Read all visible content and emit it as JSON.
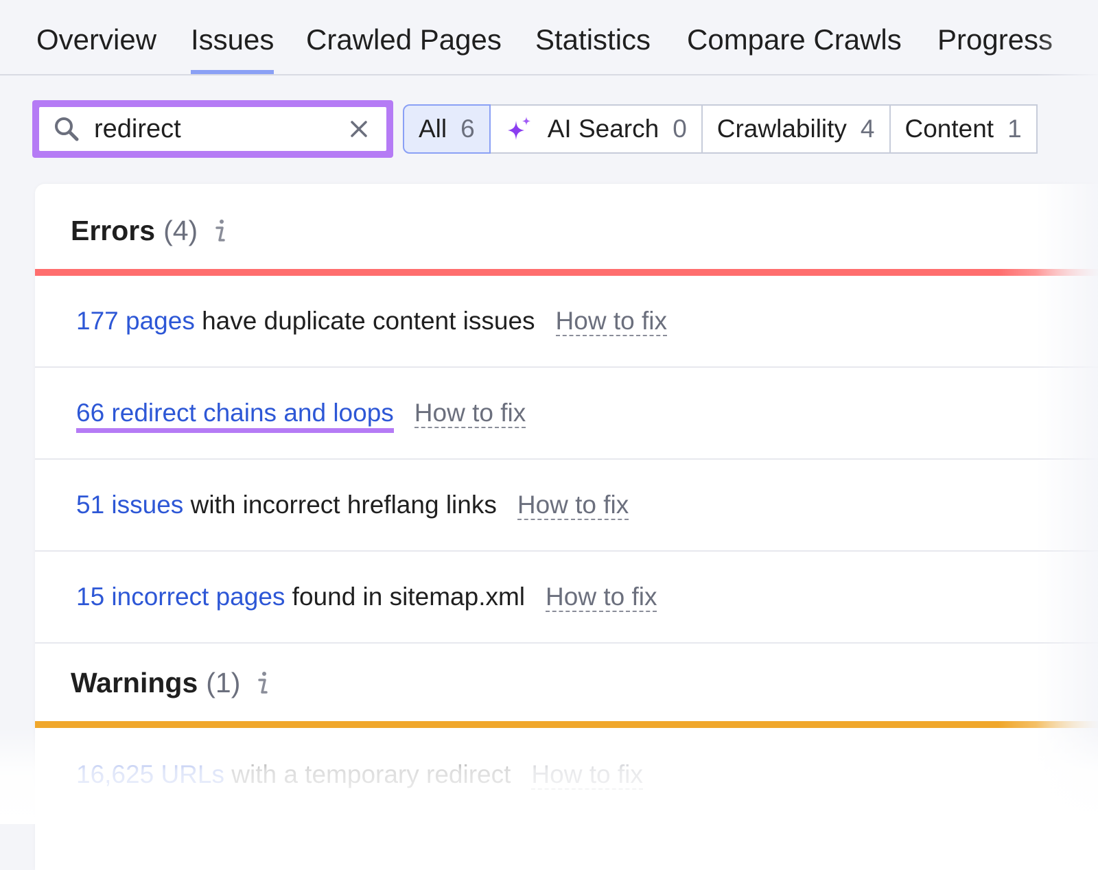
{
  "tabs": [
    {
      "label": "Overview",
      "active": false
    },
    {
      "label": "Issues",
      "active": true
    },
    {
      "label": "Crawled Pages",
      "active": false
    },
    {
      "label": "Statistics",
      "active": false
    },
    {
      "label": "Compare Crawls",
      "active": false
    },
    {
      "label": "Progress",
      "active": false
    }
  ],
  "search": {
    "value": "redirect",
    "placeholder": ""
  },
  "filters": [
    {
      "label": "All",
      "count": "6",
      "active": true
    },
    {
      "label": "AI Search",
      "count": "0",
      "icon": "sparkle-icon"
    },
    {
      "label": "Crawlability",
      "count": "4"
    },
    {
      "label": "Content",
      "count": "1"
    }
  ],
  "errors": {
    "title": "Errors",
    "count": "(4)",
    "items": [
      {
        "link": "177 pages",
        "text": " have duplicate content issues",
        "how_to_fix": "How to fix"
      },
      {
        "link": "66 redirect chains and loops",
        "text": "",
        "how_to_fix": "How to fix"
      },
      {
        "link": "51 issues",
        "text": " with incorrect hreflang links",
        "how_to_fix": "How to fix"
      },
      {
        "link": "15 incorrect pages",
        "text": " found in sitemap.xml",
        "how_to_fix": "How to fix"
      }
    ]
  },
  "warnings": {
    "title": "Warnings",
    "count": "(1)",
    "items": [
      {
        "link": "16,625 URLs",
        "text": " with a temporary redirect",
        "how_to_fix": "How to fix"
      }
    ]
  },
  "colors": {
    "accent": "#b57bf5",
    "link": "#2d57d6",
    "error_bar": "#ff6e6e",
    "warning_bar": "#f0a72b",
    "active_tab": "#8aa0f5"
  }
}
